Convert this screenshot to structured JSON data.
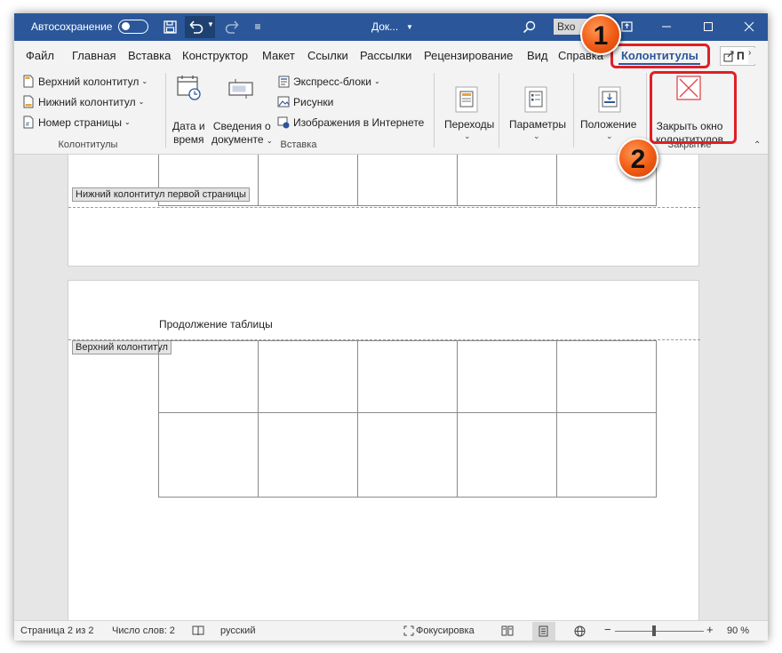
{
  "titlebar": {
    "autosave_label": "Автосохранение",
    "doc_title": "Док...",
    "signin_label": "Вхо"
  },
  "tabs": [
    "Файл",
    "Главная",
    "Вставка",
    "Конструктор",
    "Макет",
    "Ссылки",
    "Рассылки",
    "Рецензирование",
    "Вид",
    "Справка",
    "Колонтитулы"
  ],
  "share_label": "П",
  "ribbon": {
    "kolontituly": {
      "label": "Колонтитулы",
      "items": [
        "Верхний колонтитул",
        "Нижний колонтитул",
        "Номер страницы"
      ]
    },
    "vstavka": {
      "label": "Вставка",
      "date_time": [
        "Дата и",
        "время"
      ],
      "doc_info": [
        "Сведения о",
        "документе"
      ],
      "items": [
        "Экспресс-блоки",
        "Рисунки",
        "Изображения в Интернете"
      ]
    },
    "perehody": "Переходы",
    "parametry": "Параметры",
    "polozhenie": "Положение",
    "zakrytie": {
      "label": "Закрытие",
      "button": [
        "Закрыть окно",
        "колонтитулов"
      ]
    }
  },
  "document": {
    "footer_tag": "Нижний колонтитул первой страницы",
    "header_tag": "Верхний колонтитул",
    "continuation_text": "Продолжение таблицы"
  },
  "statusbar": {
    "page": "Страница 2 из 2",
    "words": "Число слов: 2",
    "language": "русский",
    "focus": "Фокусировка",
    "zoom_minus": "−",
    "zoom_plus": "+",
    "zoom": "90 %"
  },
  "callouts": [
    "1",
    "2"
  ],
  "colors": {
    "accent": "#2b579a",
    "highlight": "#e01f24",
    "badge": "#f05a14"
  }
}
